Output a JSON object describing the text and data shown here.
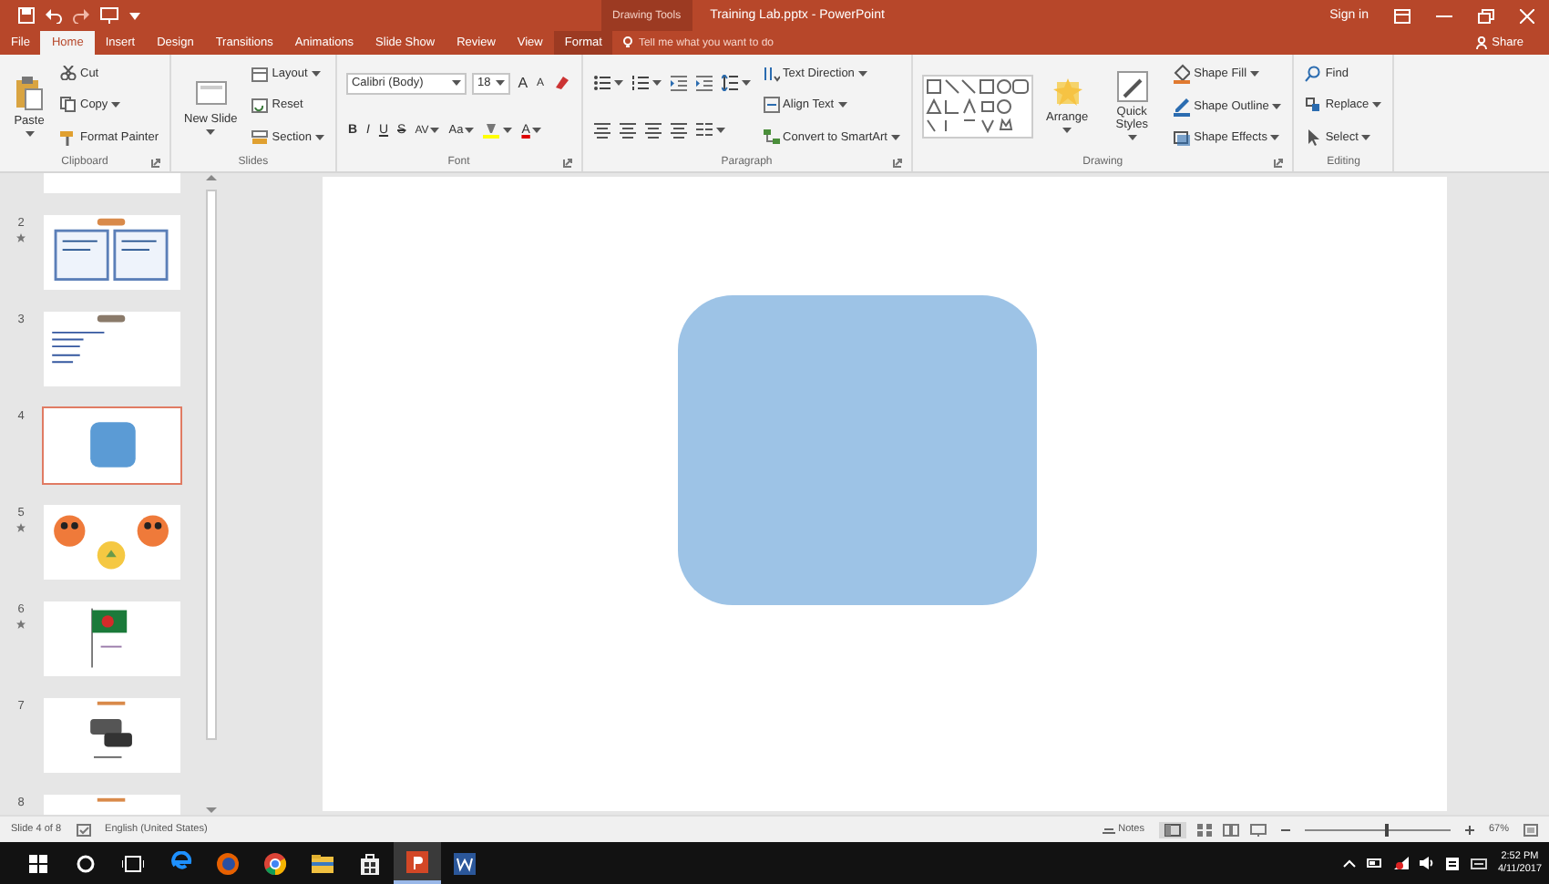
{
  "window": {
    "title": "Training Lab.pptx - PowerPoint",
    "context_group": "Drawing Tools",
    "sign_in": "Sign in",
    "share": "Share"
  },
  "tabs": [
    {
      "label": "File",
      "selected": false,
      "contextual": false
    },
    {
      "label": "Home",
      "selected": true,
      "contextual": false
    },
    {
      "label": "Insert",
      "selected": false,
      "contextual": false
    },
    {
      "label": "Design",
      "selected": false,
      "contextual": false
    },
    {
      "label": "Transitions",
      "selected": false,
      "contextual": false
    },
    {
      "label": "Animations",
      "selected": false,
      "contextual": false
    },
    {
      "label": "Slide Show",
      "selected": false,
      "contextual": false
    },
    {
      "label": "Review",
      "selected": false,
      "contextual": false
    },
    {
      "label": "View",
      "selected": false,
      "contextual": false
    },
    {
      "label": "Format",
      "selected": false,
      "contextual": true
    }
  ],
  "tell_me": {
    "placeholder": "Tell me what you want to do"
  },
  "ribbon": {
    "groups": [
      {
        "name": "Clipboard",
        "launcher": true,
        "columns": [
          [
            [
              {
                "kind": "paste",
                "label": "Paste",
                "dropdown": true
              }
            ]
          ],
          [
            [
              {
                "kind": "cut",
                "label": "Cut",
                "dropdown": false
              }
            ],
            [
              {
                "kind": "copy",
                "label": "Copy",
                "dropdown": true
              }
            ],
            [
              {
                "kind": "painter",
                "label": "Format Painter",
                "dropdown": false
              }
            ]
          ]
        ]
      },
      {
        "name": "Slides",
        "launcher": false,
        "columns": [
          [
            [
              {
                "kind": "new-slide",
                "label": "New Slide",
                "dropdown": true
              }
            ]
          ],
          [
            [
              {
                "kind": "layout",
                "label": "Layout",
                "dropdown": true
              }
            ],
            [
              {
                "kind": "reset",
                "label": "Reset",
                "dropdown": false
              }
            ],
            [
              {
                "kind": "section",
                "label": "Section",
                "dropdown": true
              }
            ]
          ]
        ]
      },
      {
        "name": "Font",
        "launcher": true,
        "columns": [
          [
            [
              {
                "kind": "font-name",
                "label": "Calibri (Body)",
                "dropdown": true
              },
              {
                "kind": "font-size",
                "label": "18",
                "dropdown": true
              },
              {
                "kind": "grow",
                "label": "A",
                "dropdown": false
              },
              {
                "kind": "shrink",
                "label": "A",
                "dropdown": false
              },
              {
                "kind": "clear",
                "dropdown": false
              }
            ],
            [
              {
                "kind": "bold",
                "label": "B",
                "dropdown": false
              },
              {
                "kind": "italic",
                "label": "I",
                "dropdown": false
              },
              {
                "kind": "underline",
                "label": "U",
                "dropdown": false
              },
              {
                "kind": "strike",
                "label": "S",
                "dropdown": false
              },
              {
                "kind": "spacing",
                "label": "AV",
                "dropdown": true
              },
              {
                "kind": "case",
                "label": "Aa",
                "dropdown": true
              },
              {
                "kind": "highlight",
                "dropdown": true
              },
              {
                "kind": "font-color",
                "label": "A",
                "dropdown": true
              }
            ]
          ]
        ]
      },
      {
        "name": "Paragraph",
        "launcher": true,
        "columns": [
          [
            [
              {
                "kind": "bullets",
                "dropdown": true
              },
              {
                "kind": "numbering",
                "dropdown": true
              },
              {
                "kind": "indent",
                "dropdown": false
              },
              {
                "kind": "indent",
                "dropdown": false
              },
              {
                "kind": "line-spacing",
                "dropdown": true
              }
            ],
            [
              {
                "kind": "align",
                "dropdown": false
              },
              {
                "kind": "align",
                "dropdown": false
              },
              {
                "kind": "align",
                "dropdown": false
              },
              {
                "kind": "align",
                "dropdown": false
              },
              {
                "kind": "columns",
                "dropdown": true
              }
            ]
          ],
          [
            [
              {
                "kind": "text-direction",
                "label": "Text Direction",
                "dropdown": true
              }
            ],
            [
              {
                "kind": "align-text",
                "label": "Align Text",
                "dropdown": true
              }
            ],
            [
              {
                "kind": "smartart",
                "label": "Convert to SmartArt",
                "dropdown": true
              }
            ]
          ]
        ]
      },
      {
        "name": "Drawing",
        "launcher": true,
        "columns": [
          [
            [
              {
                "kind": "shapes",
                "dropdown": false
              }
            ]
          ],
          [
            [
              {
                "kind": "arrange",
                "label": "Arrange",
                "dropdown": true
              }
            ]
          ],
          [
            [
              {
                "kind": "quick-styles",
                "label": "Quick Styles",
                "dropdown": true
              }
            ]
          ],
          [
            [
              {
                "kind": "shape-fill",
                "label": "Shape Fill",
                "dropdown": true
              }
            ],
            [
              {
                "kind": "shape-outline",
                "label": "Shape Outline",
                "dropdown": true
              }
            ],
            [
              {
                "kind": "shape-effects",
                "label": "Shape Effects",
                "dropdown": true
              }
            ]
          ]
        ]
      },
      {
        "name": "Editing",
        "launcher": false,
        "columns": [
          [
            [
              {
                "kind": "find",
                "label": "Find",
                "dropdown": false
              }
            ],
            [
              {
                "kind": "replace",
                "label": "Replace",
                "dropdown": true
              }
            ],
            [
              {
                "kind": "select",
                "label": "Select",
                "dropdown": true
              }
            ]
          ]
        ]
      }
    ]
  },
  "slides": [
    {
      "selected": false,
      "animated": false,
      "kind": "blank"
    },
    {
      "number": "2",
      "selected": false,
      "animated": true,
      "kind": "certificates"
    },
    {
      "number": "3",
      "selected": false,
      "animated": false,
      "kind": "text"
    },
    {
      "number": "4",
      "selected": true,
      "animated": false,
      "kind": "shape"
    },
    {
      "number": "5",
      "selected": false,
      "animated": true,
      "kind": "faces"
    },
    {
      "number": "6",
      "selected": false,
      "animated": true,
      "kind": "flag"
    },
    {
      "number": "7",
      "selected": false,
      "animated": false,
      "kind": "cameras"
    },
    {
      "number": "8",
      "selected": false,
      "animated": false,
      "kind": "banner"
    }
  ],
  "status_bar": {
    "slide_info": "Slide 4 of 8",
    "language": "English (United States)",
    "notes": "Notes",
    "zoom": {
      "level": 0.55,
      "reading": "67%"
    }
  },
  "taskbar": {
    "apps": [
      {
        "kind": "edge",
        "active": false
      },
      {
        "kind": "firefox",
        "active": false
      },
      {
        "kind": "chrome",
        "active": false
      },
      {
        "kind": "explorer",
        "active": false
      },
      {
        "kind": "store",
        "active": false
      },
      {
        "kind": "powerpoint",
        "active": true
      },
      {
        "kind": "word",
        "active": false
      }
    ],
    "time": "2:52 PM",
    "date": "4/11/2017"
  }
}
